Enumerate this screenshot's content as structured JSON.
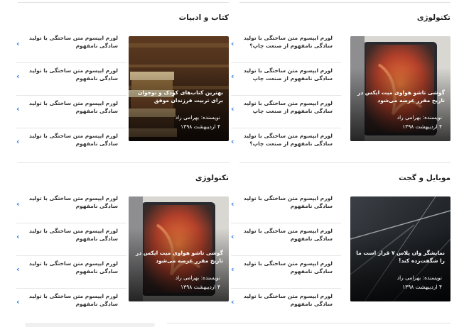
{
  "sections": [
    {
      "id": "tech-top",
      "title": "تکنولوژی",
      "feature": {
        "image": "foldable-phone",
        "title": "گوشی تاشو هواوی میت ایکس در تاریخ مقرر عرضه می‌شود",
        "author": "نویسنده: بهرامی راد",
        "date": "۴ اردیبهشت ۱۳۹۸"
      },
      "items": [
        "لورم ایپسوم متن ساختگی با تولید سادگی نامفهوم از صنعت چاپ؟",
        "لورم ایپسوم متن ساختگی با تولید سادگی نامفهوم از صنعت چاپ",
        "لورم ایپسوم متن ساختگی با تولید سادگی نامفهوم از صنعت چاپ",
        "لورم ایپسوم متن ساختگی با تولید سادگی نامفهوم از صنعت چاپ؟"
      ]
    },
    {
      "id": "books",
      "title": "کتاب و ادبیات",
      "feature": {
        "image": "book-stack",
        "title": "بهترین کتاب‌های کودک و نوجوان برای تربیت فرزندان موفق",
        "author": "نویسنده: بهرامی راد",
        "date": "۴ اردیبهشت ۱۳۹۸"
      },
      "items": [
        "لورم ایپسوم متن ساختگی با تولید سادگی نامفهوم",
        "لورم ایپسوم متن ساختگی با تولید سادگی نامفهوم",
        "لورم ایپسوم متن ساختگی با تولید سادگی نامفهوم",
        "لورم ایپسوم متن ساختگی با تولید سادگی نامفهوم"
      ]
    },
    {
      "id": "mobile",
      "title": "موبایل و گجت",
      "feature": {
        "image": "oneplus-phone",
        "title": "نمایشگر وان پلاس ۷ قرار است ما را شگفت‌زده کند!",
        "author": "نویسنده: بهرامی راد",
        "date": "۴ اردیبهشت ۱۳۹۸"
      },
      "items": [
        "لورم ایپسوم متن ساختگی با تولید سادگی نامفهوم",
        "لورم ایپسوم متن ساختگی با تولید سادگی نامفهوم",
        "لورم ایپسوم متن ساختگی با تولید سادگی نامفهوم",
        "لورم ایپسوم متن ساختگی با تولید سادگی نامفهوم"
      ]
    },
    {
      "id": "tech-bottom",
      "title": "تکنولوژی",
      "feature": {
        "image": "foldable-phone",
        "title": "گوشی تاشو هواوی میت ایکس در تاریخ مقرر عرضه می‌شود",
        "author": "نویسنده: بهرامی راد",
        "date": "۴ اردیبهشت ۱۳۹۸"
      },
      "items": [
        "لورم ایپسوم متن ساختگی با تولید سادگی نامفهوم",
        "لورم ایپسوم متن ساختگی با تولید سادگی نامفهوم",
        "لورم ایپسوم متن ساختگی با تولید سادگی نامفهوم",
        "لورم ایپسوم متن ساختگی با تولید سادگی نامفهوم"
      ]
    }
  ],
  "colors": {
    "accent": "#2a7be4",
    "divider": "#e2e2e2"
  },
  "icons": {
    "item_arrow": "chevron-left-icon"
  }
}
